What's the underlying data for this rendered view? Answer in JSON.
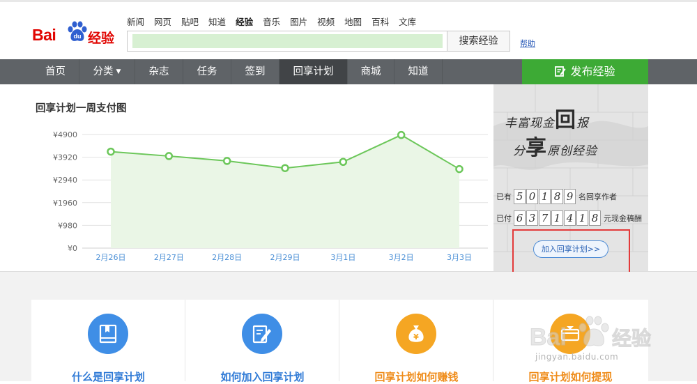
{
  "header": {
    "logo_text": "Bai",
    "logo_paw_text": "du",
    "logo_product": "经验",
    "top_nav": [
      "新闻",
      "网页",
      "贴吧",
      "知道",
      "经验",
      "音乐",
      "图片",
      "视频",
      "地图",
      "百科",
      "文库"
    ],
    "active_top_nav": "经验",
    "search_value": "",
    "search_button": "搜索经验",
    "help_link": "帮助"
  },
  "main_nav": {
    "items": [
      {
        "label": "首页"
      },
      {
        "label": "分类",
        "dropdown": true
      },
      {
        "label": "杂志"
      },
      {
        "label": "任务"
      },
      {
        "label": "签到"
      },
      {
        "label": "回享计划",
        "active": true
      },
      {
        "label": "商城"
      },
      {
        "label": "知道"
      }
    ],
    "publish_button": "发布经验"
  },
  "chart_section": {
    "title": "回享计划一周支付图"
  },
  "chart_data": {
    "type": "area",
    "title": "回享计划一周支付图",
    "categories": [
      "2月26日",
      "2月27日",
      "2月28日",
      "2月29日",
      "3月1日",
      "3月2日",
      "3月3日"
    ],
    "series": [
      {
        "values": [
          4160,
          3970,
          3760,
          3450,
          3720,
          4880,
          3410
        ]
      }
    ],
    "y_ticks": [
      "¥4900",
      "¥3920",
      "¥2940",
      "¥1960",
      "¥980",
      "¥0"
    ],
    "ylim": [
      0,
      4900
    ],
    "grid": true,
    "colors": {
      "line": "#6cc75a",
      "fill": "#eaf6e6",
      "marker_fill": "#ffffff",
      "axis_text": "#666666",
      "x_text": "#4a8fd6"
    }
  },
  "banner": {
    "slogan_line1": "丰富现金",
    "slogan_big1": "回",
    "slogan_line1_end": "报",
    "slogan_line2_start": "分",
    "slogan_big2": "享",
    "slogan_line2_end": "原创经验",
    "authors_prefix": "已有",
    "authors_digits": [
      "5",
      "0",
      "1",
      "8",
      "9"
    ],
    "authors_suffix": "名回享作者",
    "paid_prefix": "已付",
    "paid_digits": [
      "6",
      "3",
      "7",
      "1",
      "4",
      "1",
      "8"
    ],
    "paid_suffix": "元现金稿酬",
    "join_button": "加入回享计划>>"
  },
  "cards": [
    {
      "label": "什么是回享计划",
      "icon": "book-icon",
      "color": "#3f8ee6"
    },
    {
      "label": "如何加入回享计划",
      "icon": "edit-document-icon",
      "color": "#3f8ee6"
    },
    {
      "label": "回享计划如何赚钱",
      "icon": "money-bag-icon",
      "color": "#f5a623"
    },
    {
      "label": "回享计划如何提现",
      "icon": "withdraw-icon",
      "color": "#f5a623"
    }
  ],
  "watermark": {
    "text": "jingyan.baidu.com"
  },
  "colors": {
    "nav_bg": "#5f6367",
    "nav_active": "#414447",
    "publish_green": "#3daa35",
    "baidu_red": "#e10602",
    "highlight_box": "#e33a3a"
  }
}
